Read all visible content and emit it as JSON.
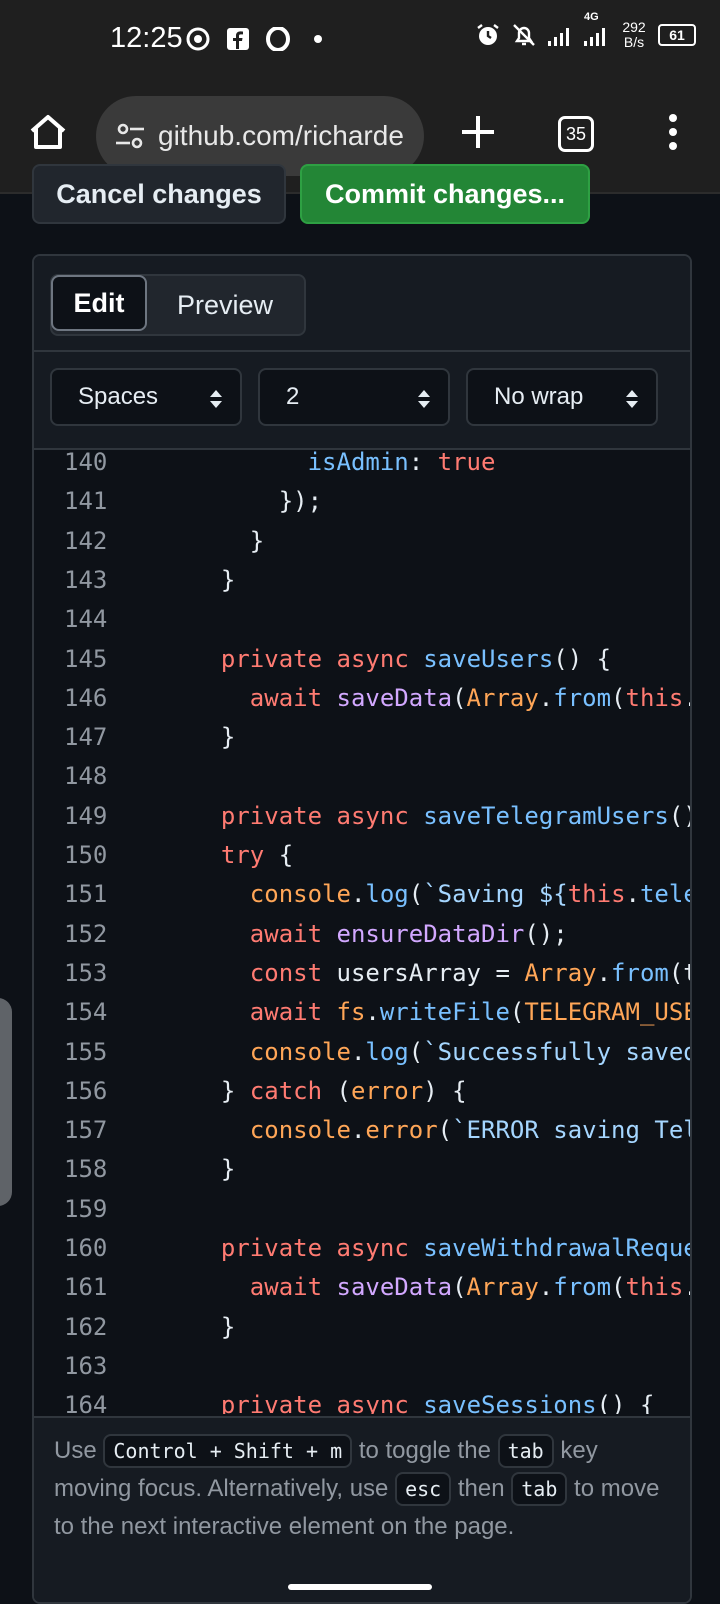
{
  "status_bar": {
    "time": "12:25",
    "network_type": "4G",
    "net_speed_value": "292",
    "net_speed_unit": "B/s",
    "battery": "61"
  },
  "browser": {
    "url": "github.com/richarde",
    "tab_count": "35"
  },
  "commit_bar": {
    "cancel_label": "Cancel changes",
    "commit_label": "Commit changes..."
  },
  "editor": {
    "tabs": [
      {
        "label": "Edit",
        "active": true
      },
      {
        "label": "Preview",
        "active": false
      }
    ],
    "indent_mode": "Spaces",
    "indent_size": "2",
    "wrap_mode": "No wrap"
  },
  "code": {
    "lines": [
      {
        "n": "140",
        "text": "        isAdmin: true"
      },
      {
        "n": "141",
        "text": "      });"
      },
      {
        "n": "142",
        "text": "    }"
      },
      {
        "n": "143",
        "text": "  }"
      },
      {
        "n": "144",
        "text": ""
      },
      {
        "n": "145",
        "text": "  private async saveUsers() {"
      },
      {
        "n": "146",
        "text": "    await saveData(Array.from(this.u"
      },
      {
        "n": "147",
        "text": "  }"
      },
      {
        "n": "148",
        "text": ""
      },
      {
        "n": "149",
        "text": "  private async saveTelegramUsers()"
      },
      {
        "n": "150",
        "text": "  try {"
      },
      {
        "n": "151",
        "text": "    console.log(`Saving ${this.teleg"
      },
      {
        "n": "152",
        "text": "    await ensureDataDir();"
      },
      {
        "n": "153",
        "text": "    const usersArray = Array.from(th"
      },
      {
        "n": "154",
        "text": "    await fs.writeFile(TELEGRAM_USER"
      },
      {
        "n": "155",
        "text": "    console.log(`Successfully saved "
      },
      {
        "n": "156",
        "text": "  } catch (error) {"
      },
      {
        "n": "157",
        "text": "    console.error(`ERROR saving Tele"
      },
      {
        "n": "158",
        "text": "  }"
      },
      {
        "n": "159",
        "text": ""
      },
      {
        "n": "160",
        "text": "  private async saveWithdrawalReques"
      },
      {
        "n": "161",
        "text": "    await saveData(Array.from(this.w"
      },
      {
        "n": "162",
        "text": "  }"
      },
      {
        "n": "163",
        "text": ""
      },
      {
        "n": "164",
        "text": "  private async saveSessions() {"
      }
    ]
  },
  "hint": {
    "use": "Use",
    "key_combo": "Control + Shift + m",
    "to_toggle": "to toggle the",
    "tab_key": "tab",
    "key_moving": "key moving focus. Alternatively, use",
    "esc_key": "esc",
    "then": "then",
    "tab_key2": "tab",
    "to_move": "to move to the next interactive element on the page."
  }
}
